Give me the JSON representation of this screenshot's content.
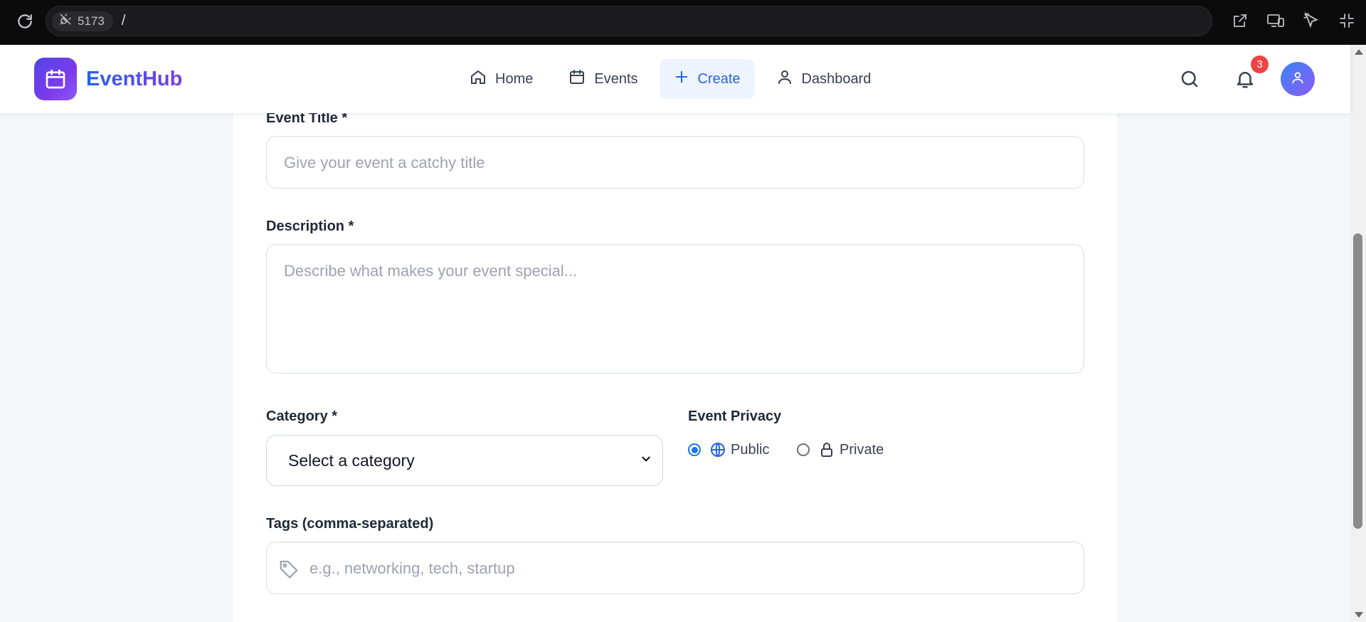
{
  "browser": {
    "port": "5173",
    "path": "/"
  },
  "header": {
    "brand": "EventHub",
    "nav": [
      {
        "label": "Home",
        "icon": "home-icon"
      },
      {
        "label": "Events",
        "icon": "calendar-icon"
      },
      {
        "label": "Create",
        "icon": "plus-icon",
        "active": true
      },
      {
        "label": "Dashboard",
        "icon": "user-icon"
      }
    ],
    "notification_count": "3"
  },
  "form": {
    "title_label": "Event Title *",
    "title_placeholder": "Give your event a catchy title",
    "description_label": "Description *",
    "description_placeholder": "Describe what makes your event special...",
    "category_label": "Category *",
    "category_value": "Select a category",
    "privacy_label": "Event Privacy",
    "privacy_options": [
      {
        "label": "Public",
        "icon": "globe-icon",
        "checked": true
      },
      {
        "label": "Private",
        "icon": "lock-icon",
        "checked": false
      }
    ],
    "tags_label": "Tags (comma-separated)",
    "tags_placeholder": "e.g., networking, tech, startup"
  },
  "colors": {
    "accent": "#2563eb",
    "brand_gradient_start": "#4f46e5",
    "brand_gradient_end": "#8b5cf6",
    "badge": "#ef4444"
  }
}
